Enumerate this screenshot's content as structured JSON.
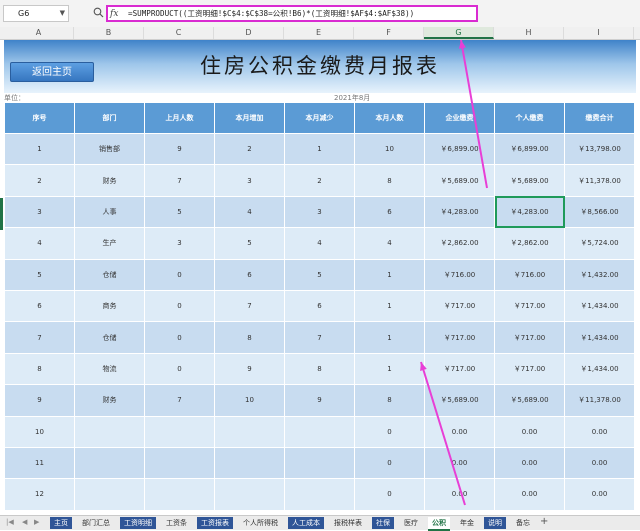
{
  "formula_bar": {
    "name_box": "G6",
    "fx_label": "fx",
    "formula": "=SUMPRODUCT((工资明细!$C$4:$C$38=公积!B6)*(工资明细!$AF$4:$AF$38))"
  },
  "column_headers": [
    "A",
    "B",
    "C",
    "D",
    "E",
    "F",
    "G",
    "H",
    "I"
  ],
  "selected_column": "G",
  "report": {
    "title": "住房公积金缴费月报表",
    "back_button": "返回主页",
    "unit_label": "单位：",
    "date": "2021年8月"
  },
  "table": {
    "headers": [
      "序号",
      "部门",
      "上月人数",
      "本月增加",
      "本月减少",
      "本月人数",
      "企业缴费",
      "个人缴费",
      "缴费合计"
    ],
    "rows": [
      [
        "1",
        "销售部",
        "9",
        "2",
        "1",
        "10",
        "￥6,899.00",
        "￥6,899.00",
        "￥13,798.00"
      ],
      [
        "2",
        "财务",
        "7",
        "3",
        "2",
        "8",
        "￥5,689.00",
        "￥5,689.00",
        "￥11,378.00"
      ],
      [
        "3",
        "人事",
        "5",
        "4",
        "3",
        "6",
        "￥4,283.00",
        "￥4,283.00",
        "￥8,566.00"
      ],
      [
        "4",
        "生产",
        "3",
        "5",
        "4",
        "4",
        "￥2,862.00",
        "￥2,862.00",
        "￥5,724.00"
      ],
      [
        "5",
        "仓储",
        "0",
        "6",
        "5",
        "1",
        "￥716.00",
        "￥716.00",
        "￥1,432.00"
      ],
      [
        "6",
        "商务",
        "0",
        "7",
        "6",
        "1",
        "￥717.00",
        "￥717.00",
        "￥1,434.00"
      ],
      [
        "7",
        "仓储",
        "0",
        "8",
        "7",
        "1",
        "￥717.00",
        "￥717.00",
        "￥1,434.00"
      ],
      [
        "8",
        "物流",
        "0",
        "9",
        "8",
        "1",
        "￥717.00",
        "￥717.00",
        "￥1,434.00"
      ],
      [
        "9",
        "财务",
        "7",
        "10",
        "9",
        "8",
        "￥5,689.00",
        "￥5,689.00",
        "￥11,378.00"
      ],
      [
        "10",
        "",
        "",
        "",
        "",
        "0",
        "0.00",
        "0.00",
        "0.00"
      ],
      [
        "11",
        "",
        "",
        "",
        "",
        "0",
        "0.00",
        "0.00",
        "0.00"
      ],
      [
        "12",
        "",
        "",
        "",
        "",
        "0",
        "0.00",
        "0.00",
        "0.00"
      ]
    ],
    "selected_cell": {
      "row": 3,
      "col": 7
    }
  },
  "sheet_tabs": [
    {
      "label": "主页",
      "style": "blue"
    },
    {
      "label": "部门汇总",
      "style": "plain"
    },
    {
      "label": "工资明细",
      "style": "blue"
    },
    {
      "label": "工资条",
      "style": "plain"
    },
    {
      "label": "工资报表",
      "style": "blue"
    },
    {
      "label": "个人所得税",
      "style": "plain"
    },
    {
      "label": "人工成本",
      "style": "blue"
    },
    {
      "label": "报税样表",
      "style": "plain"
    },
    {
      "label": "社保",
      "style": "blue"
    },
    {
      "label": "医疗",
      "style": "plain"
    },
    {
      "label": "公积",
      "style": "active"
    },
    {
      "label": "年金",
      "style": "plain"
    },
    {
      "label": "说明",
      "style": "blue"
    },
    {
      "label": "备忘",
      "style": "plain"
    }
  ],
  "annotation_color": "#e83fd6"
}
